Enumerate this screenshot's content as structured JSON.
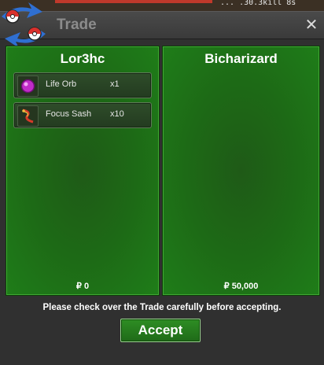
{
  "background": {
    "glimpse_text": "...  .30.3kill 8s"
  },
  "window": {
    "title": "Trade",
    "close_label": "✕"
  },
  "trade": {
    "left": {
      "player_name": "Lor3hc",
      "items": [
        {
          "name": "Life Orb",
          "quantity": "x1",
          "icon": "life-orb-icon"
        },
        {
          "name": "Focus Sash",
          "quantity": "x10",
          "icon": "focus-sash-icon"
        }
      ],
      "money": "₽ 0"
    },
    "right": {
      "player_name": "Bicharizard",
      "items": [],
      "money": "₽ 50,000"
    }
  },
  "notice": "Please check over the Trade carefully before accepting.",
  "accept_label": "Accept",
  "colors": {
    "panel_green": "#1d6a16",
    "accept_green": "#2e8e24",
    "title_gray": "#8c8c8c"
  }
}
